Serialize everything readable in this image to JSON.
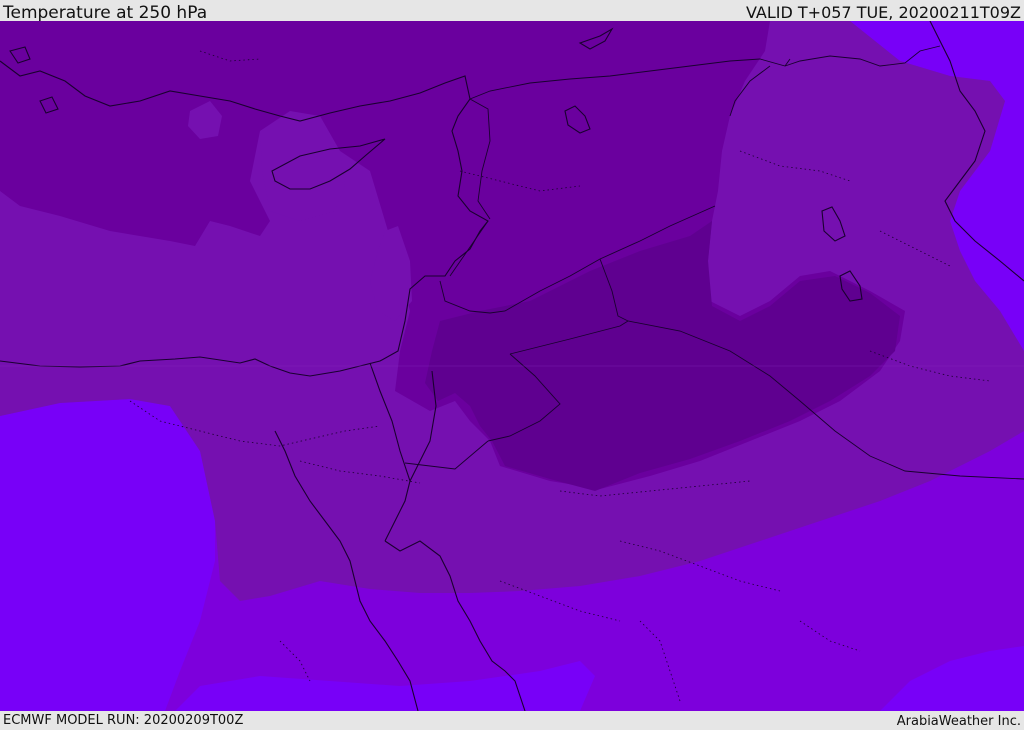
{
  "header": {
    "title": "Temperature at 250 hPa",
    "valid": "VALID T+057 TUE, 20200211T09Z"
  },
  "footer": {
    "model_run": "ECMWF MODEL RUN: 20200209T00Z",
    "credit": "ArabiaWeather Inc."
  },
  "colors": {
    "darkest": "#5f0090",
    "dark": "#6a009e",
    "medium": "#7510b0",
    "light": "#7d00dc",
    "lightest": "#7800f8",
    "lines": "#1a0030"
  }
}
